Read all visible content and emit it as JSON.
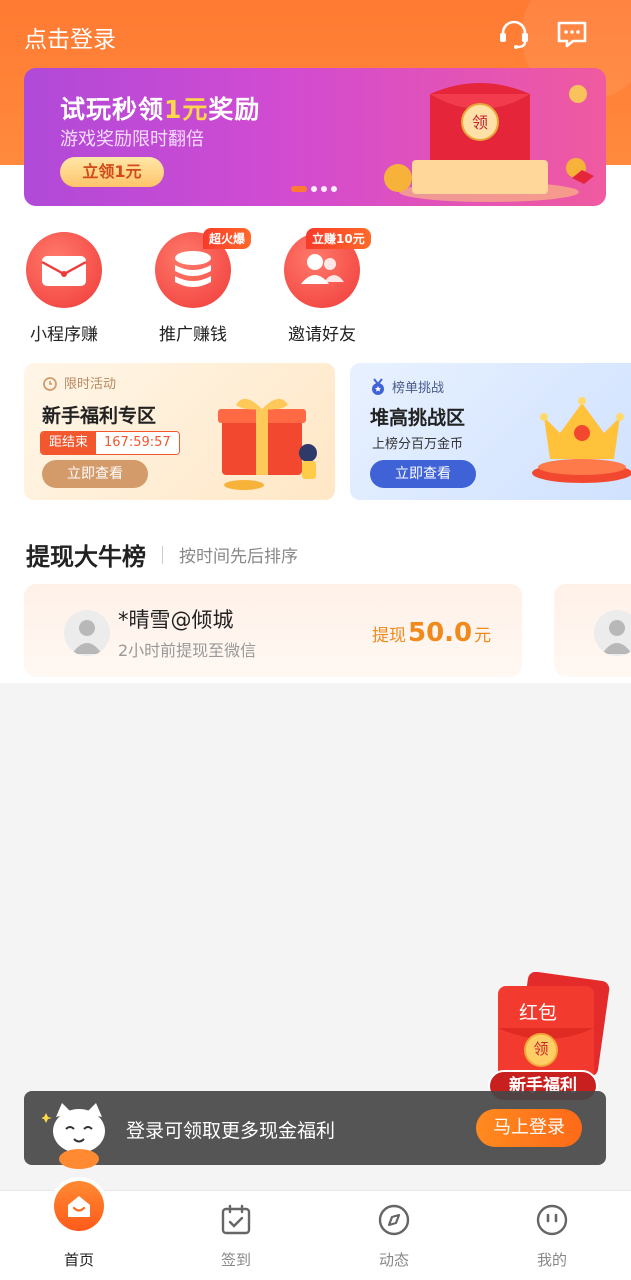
{
  "header": {
    "login_link": "点击登录",
    "service_icon": "headset-icon",
    "message_icon": "message-icon"
  },
  "banner": {
    "title_prefix": "试玩秒领",
    "title_highlight": "1元",
    "title_suffix": "奖励",
    "subtitle": "游戏奖励限时翻倍",
    "button": "立领1元",
    "slides": 4,
    "active_slide": 1,
    "badge": "领"
  },
  "quick_actions": [
    {
      "label": "小程序赚",
      "icon": "red-envelope-icon",
      "badge": ""
    },
    {
      "label": "推广赚钱",
      "icon": "coin-stack-icon",
      "badge": "超火爆"
    },
    {
      "label": "邀请好友",
      "icon": "users-icon",
      "badge": "立赚10元"
    }
  ],
  "promo_cards": {
    "left": {
      "tag": "限时活动",
      "title": "新手福利专区",
      "countdown_label": "距结束",
      "countdown_time": "167:59:57",
      "button": "立即查看"
    },
    "right": {
      "tag": "榜单挑战",
      "title": "堆高挑战区",
      "subtitle": "上榜分百万金币",
      "button": "立即查看"
    }
  },
  "ranking": {
    "title": "提现大牛榜",
    "subtitle": "按时间先后排序",
    "items": [
      {
        "name": "*晴雪@倾城",
        "time": "2小时前提现至微信",
        "amount_prefix": "提现",
        "amount": "50.0",
        "amount_unit": "元"
      }
    ]
  },
  "floating_redpack": {
    "top_text": "红包",
    "center_text": "领",
    "ribbon": "新手福利"
  },
  "login_bar": {
    "text": "登录可领取更多现金福利",
    "button": "马上登录"
  },
  "bottom_nav": [
    {
      "label": "首页",
      "icon": "home-icon",
      "active": true
    },
    {
      "label": "签到",
      "icon": "calendar-check-icon",
      "active": false
    },
    {
      "label": "动态",
      "icon": "compass-icon",
      "active": false
    },
    {
      "label": "我的",
      "icon": "smiley-face-icon",
      "active": false
    }
  ],
  "colors": {
    "brand_orange": "#ff7a32",
    "banner_purple": "#c54ad6",
    "amount_orange": "#f08a1c",
    "red": "#f03a3a",
    "blue_button": "#3f63d6"
  }
}
